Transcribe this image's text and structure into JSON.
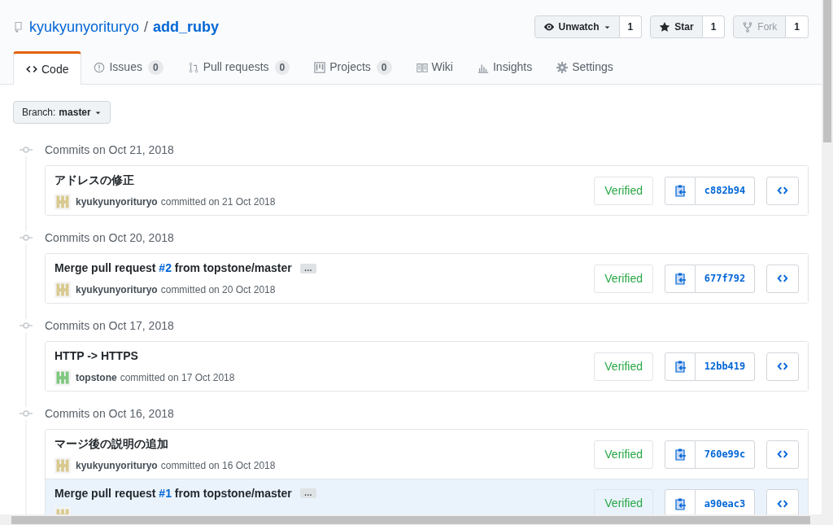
{
  "repo": {
    "owner": "kyukyunyorituryo",
    "separator": "/",
    "name": "add_ruby"
  },
  "actions": [
    {
      "kind": "watch",
      "label": "Unwatch",
      "count": "1",
      "disabled": false
    },
    {
      "kind": "star",
      "label": "Star",
      "count": "1",
      "disabled": false
    },
    {
      "kind": "fork",
      "label": "Fork",
      "count": "1",
      "disabled": true
    }
  ],
  "tabs": [
    {
      "kind": "code",
      "label": "Code",
      "selected": true
    },
    {
      "kind": "issues",
      "label": "Issues",
      "count": "0",
      "selected": false
    },
    {
      "kind": "pulls",
      "label": "Pull requests",
      "count": "0",
      "selected": false
    },
    {
      "kind": "projects",
      "label": "Projects",
      "count": "0",
      "selected": false
    },
    {
      "kind": "wiki",
      "label": "Wiki",
      "selected": false
    },
    {
      "kind": "insights",
      "label": "Insights",
      "selected": false
    },
    {
      "kind": "settings",
      "label": "Settings",
      "selected": false
    }
  ],
  "branch": {
    "label": "Branch:",
    "value": "master"
  },
  "groups": [
    {
      "heading": "Commits on Oct 21, 2018",
      "commits": [
        {
          "title": [
            {
              "kind": "text",
              "text": "アドレスの修正"
            }
          ],
          "color": "#d9c98f",
          "author": "kyukyunyorituryo",
          "meta": "committed on 21 Oct 2018",
          "verified": "Verified",
          "sha": "c882b94",
          "hovered": false
        }
      ]
    },
    {
      "heading": "Commits on Oct 20, 2018",
      "commits": [
        {
          "title": [
            {
              "kind": "text",
              "text": "Merge pull request "
            },
            {
              "kind": "link",
              "text": "#2"
            },
            {
              "kind": "text",
              "text": " from topstone/master"
            }
          ],
          "expander": "…",
          "color": "#d9c98f",
          "author": "kyukyunyorituryo",
          "meta": "committed on 20 Oct 2018",
          "verified": "Verified",
          "sha": "677f792",
          "hovered": false
        }
      ]
    },
    {
      "heading": "Commits on Oct 17, 2018",
      "commits": [
        {
          "title": [
            {
              "kind": "text",
              "text": "HTTP -> HTTPS"
            }
          ],
          "color": "#7fc77f",
          "author": "topstone",
          "meta": "committed on 17 Oct 2018",
          "verified": "Verified",
          "sha": "12bb419",
          "hovered": false
        }
      ]
    },
    {
      "heading": "Commits on Oct 16, 2018",
      "commits": [
        {
          "title": [
            {
              "kind": "text",
              "text": "マージ後の説明の追加"
            }
          ],
          "color": "#d9c98f",
          "author": "kyukyunyorituryo",
          "meta": "committed on 16 Oct 2018",
          "verified": "Verified",
          "sha": "760e99c",
          "hovered": false
        },
        {
          "title": [
            {
              "kind": "text",
              "text": "Merge pull request "
            },
            {
              "kind": "link",
              "text": "#1"
            },
            {
              "kind": "text",
              "text": " from topstone/master"
            }
          ],
          "expander": "…",
          "color": "#d9c98f",
          "verified": "Verified",
          "sha": "a90eac3",
          "hovered": true
        }
      ]
    }
  ]
}
